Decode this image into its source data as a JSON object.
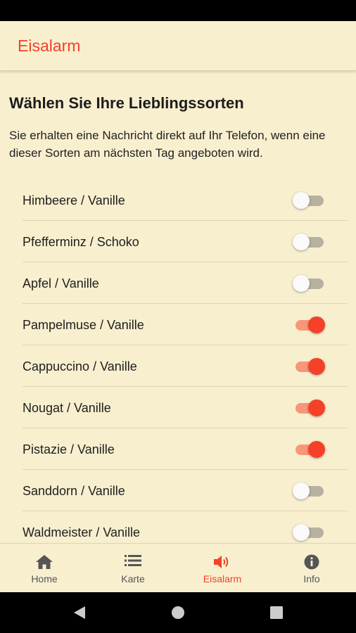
{
  "app_bar": {
    "title": "Eisalarm"
  },
  "main": {
    "heading": "Wählen Sie Ihre Lieblingssorten",
    "description": "Sie erhalten eine Nachricht direkt auf Ihr Telefon, wenn eine dieser Sorten am nächsten Tag angeboten wird.",
    "flavors": [
      {
        "label": "Himbeere / Vanille",
        "enabled": false
      },
      {
        "label": "Pfefferminz / Schoko",
        "enabled": false
      },
      {
        "label": "Apfel / Vanille",
        "enabled": false
      },
      {
        "label": "Pampelmuse / Vanille",
        "enabled": true
      },
      {
        "label": "Cappuccino / Vanille",
        "enabled": true
      },
      {
        "label": "Nougat / Vanille",
        "enabled": true
      },
      {
        "label": "Pistazie / Vanille",
        "enabled": true
      },
      {
        "label": "Sanddorn / Vanille",
        "enabled": false
      },
      {
        "label": "Waldmeister / Vanille",
        "enabled": false
      }
    ]
  },
  "bottom_nav": {
    "items": [
      {
        "label": "Home",
        "icon": "home-icon"
      },
      {
        "label": "Karte",
        "icon": "list-icon"
      },
      {
        "label": "Eisalarm",
        "icon": "speaker-icon",
        "active": true
      },
      {
        "label": "Info",
        "icon": "info-icon"
      }
    ]
  },
  "colors": {
    "accent": "#f44128",
    "background": "#f8efcf",
    "toggle_track_on": "#f89679",
    "toggle_track_off": "#b7b1a0"
  }
}
